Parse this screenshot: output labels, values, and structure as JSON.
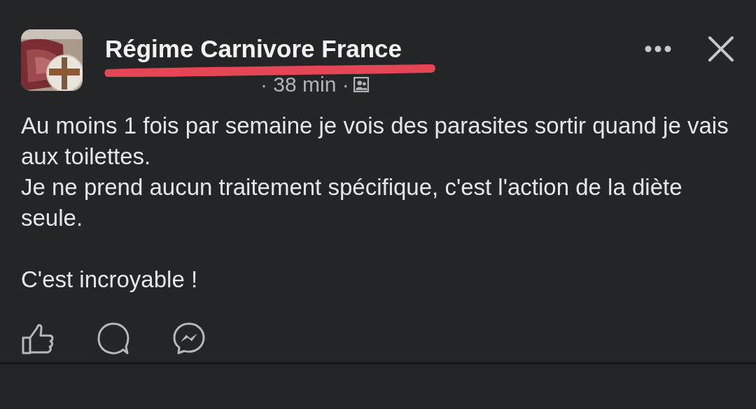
{
  "post": {
    "author": "Régime Carnivore France",
    "time": "· 38 min ·",
    "paragraphs": [
      "Au moins 1 fois par semaine je vois des parasites sortir quand je vais aux toilettes.",
      "Je ne prend aucun traitement spécifique, c'est l'action de la diète seule.",
      "C'est incroyable !"
    ]
  }
}
